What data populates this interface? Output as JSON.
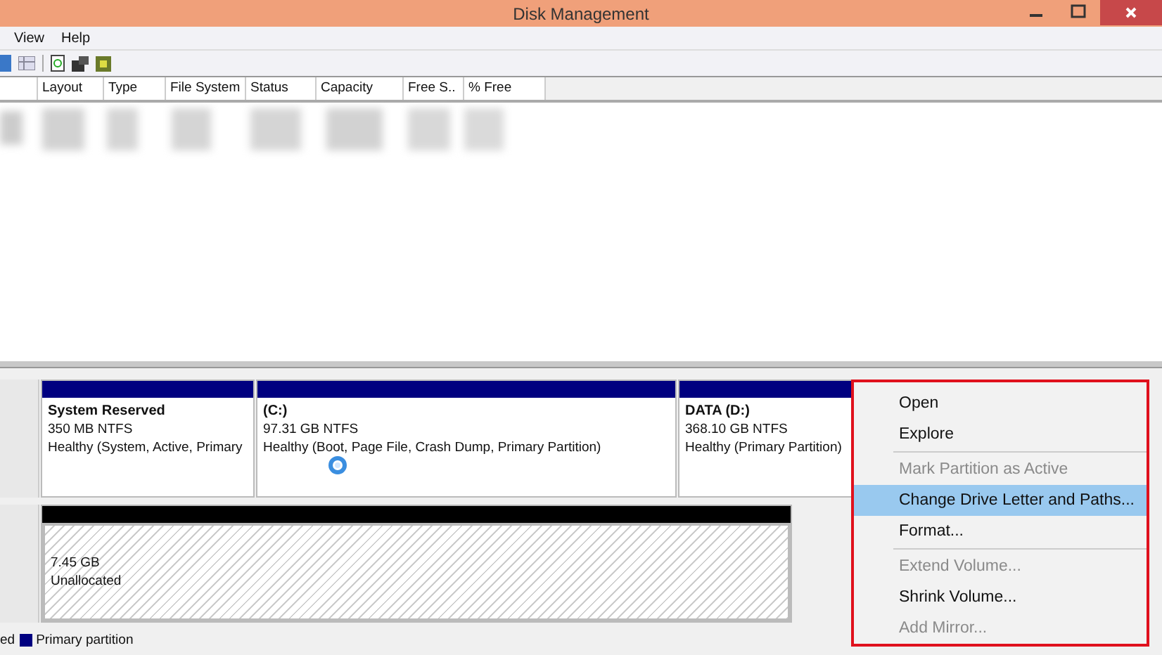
{
  "window": {
    "title": "Disk Management"
  },
  "menu_bar": [
    "View",
    "Help"
  ],
  "volume_list": {
    "columns": [
      "",
      "Layout",
      "Type",
      "File System",
      "Status",
      "Capacity",
      "Free S..",
      "% Free"
    ]
  },
  "disks": [
    {
      "partitions": [
        {
          "kind": "primary",
          "name": "System Reserved",
          "size": "350 MB NTFS",
          "status": "Healthy (System, Active, Primary"
        },
        {
          "kind": "primary",
          "name": "(C:)",
          "size": "97.31 GB NTFS",
          "status": "Healthy (Boot, Page File, Crash Dump, Primary Partition)"
        },
        {
          "kind": "primary",
          "name": "DATA  (D:)",
          "size": "368.10 GB NTFS",
          "status": "Healthy (Primary Partition)"
        }
      ]
    },
    {
      "partitions": [
        {
          "kind": "unallocated",
          "size": "7.45 GB",
          "status": "Unallocated"
        }
      ]
    }
  ],
  "legend": [
    {
      "label": "ed"
    },
    {
      "label": "Primary partition",
      "color": "#000080"
    }
  ],
  "context_menu": [
    {
      "kind": "item",
      "label": "Open",
      "disabled": false,
      "selected": false
    },
    {
      "kind": "item",
      "label": "Explore",
      "disabled": false,
      "selected": false
    },
    {
      "kind": "separator"
    },
    {
      "kind": "item",
      "label": "Mark Partition as Active",
      "disabled": true,
      "selected": false
    },
    {
      "kind": "item",
      "label": "Change Drive Letter and Paths...",
      "disabled": false,
      "selected": true
    },
    {
      "kind": "item",
      "label": "Format...",
      "disabled": false,
      "selected": false
    },
    {
      "kind": "separator"
    },
    {
      "kind": "item",
      "label": "Extend Volume...",
      "disabled": true,
      "selected": false
    },
    {
      "kind": "item",
      "label": "Shrink Volume...",
      "disabled": false,
      "selected": false
    },
    {
      "kind": "item",
      "label": "Add Mirror...",
      "disabled": true,
      "selected": false
    }
  ]
}
